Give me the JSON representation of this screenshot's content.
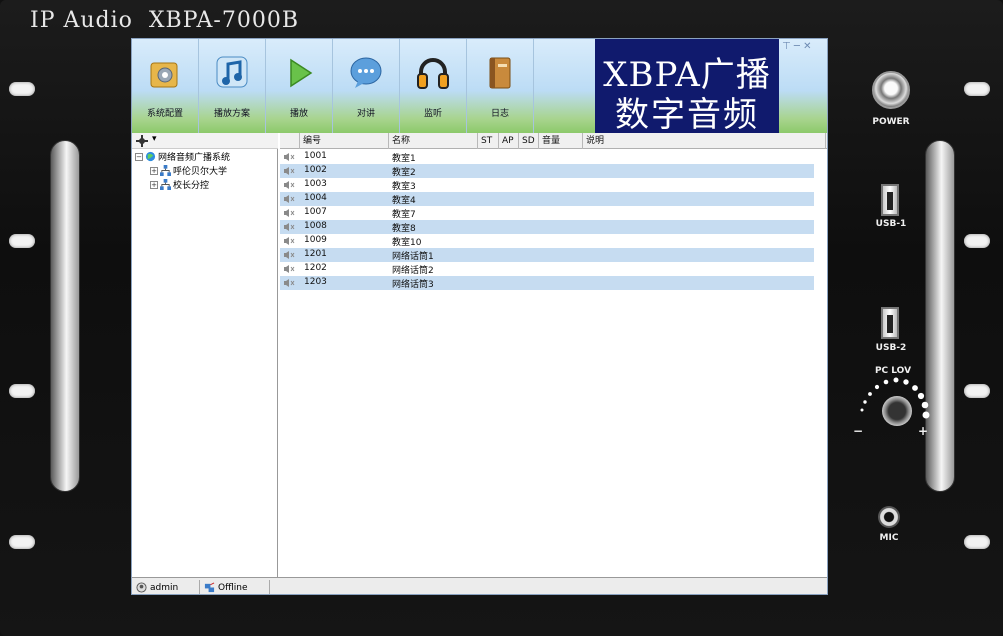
{
  "device": {
    "title": "IP Audio  XBPA-7000B"
  },
  "toolbar": {
    "items": [
      {
        "label": "系统配置",
        "icon": "system-config-icon"
      },
      {
        "label": "播放方案",
        "icon": "music-note-icon"
      },
      {
        "label": "播放",
        "icon": "play-icon"
      },
      {
        "label": "对讲",
        "icon": "chat-bubble-icon"
      },
      {
        "label": "监听",
        "icon": "headphones-icon"
      },
      {
        "label": "日志",
        "icon": "log-book-icon"
      }
    ],
    "brand_line1": "XBPA广播",
    "brand_line2": "数字音频",
    "window_controls": "⊤ ─ ✕"
  },
  "tree": {
    "header_caret": "▾",
    "root": "网络音频广播系统",
    "children": [
      "呼伦贝尔大学",
      "校长分控"
    ]
  },
  "grid": {
    "columns": [
      "编号",
      "名称",
      "ST",
      "AP",
      "SD",
      "音量",
      "说明"
    ],
    "rows": [
      {
        "id": "1001",
        "name": "教室1"
      },
      {
        "id": "1002",
        "name": "教室2"
      },
      {
        "id": "1003",
        "name": "教室3"
      },
      {
        "id": "1004",
        "name": "教室4"
      },
      {
        "id": "1007",
        "name": "教室7"
      },
      {
        "id": "1008",
        "name": "教室8"
      },
      {
        "id": "1009",
        "name": "教室10"
      },
      {
        "id": "1201",
        "name": "网络话筒1"
      },
      {
        "id": "1202",
        "name": "网络话筒2"
      },
      {
        "id": "1203",
        "name": "网络话筒3"
      }
    ]
  },
  "status": {
    "user": "admin",
    "connection": "Offline"
  },
  "panel": {
    "power": "POWER",
    "usb1": "USB-1",
    "usb2": "USB-2",
    "pc_lov": "PC LOV",
    "minus": "−",
    "plus": "+",
    "mic": "MIC"
  }
}
